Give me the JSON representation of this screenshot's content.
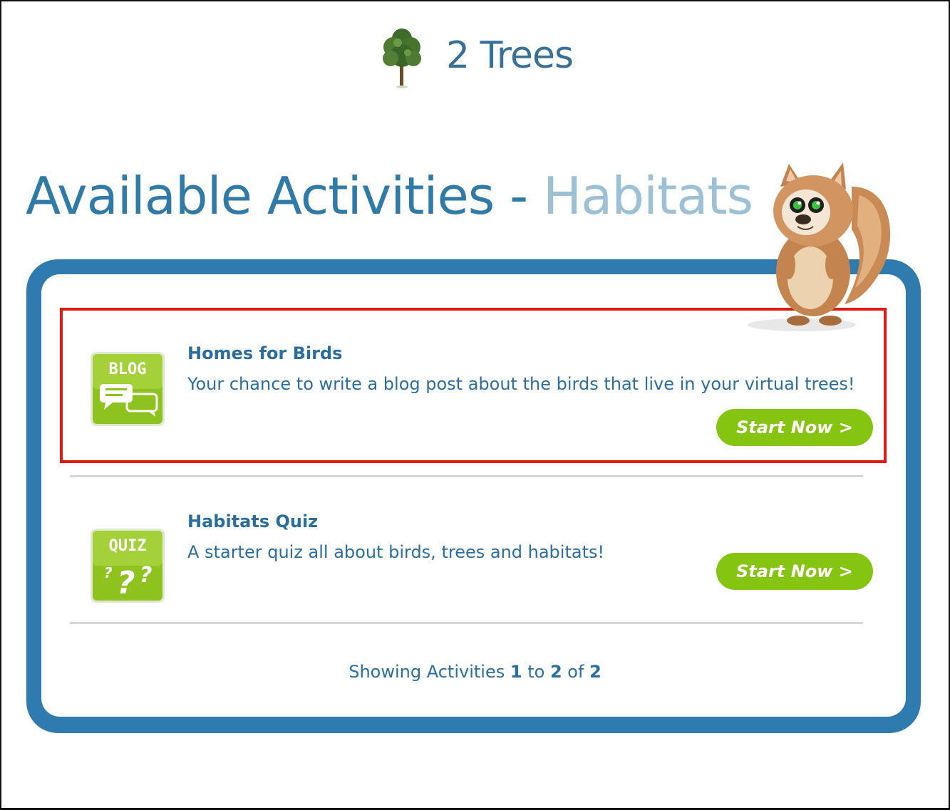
{
  "brand": {
    "name": "2 Trees"
  },
  "page": {
    "title_main": "Available Activities",
    "title_sep": "-",
    "title_sub": "Habitats"
  },
  "activities": [
    {
      "icon_name": "blog-icon",
      "icon_label": "BLOG",
      "title": "Homes for Birds",
      "description": "Your chance to write a blog post about the birds that live in your virtual trees!",
      "button_label": "Start Now >"
    },
    {
      "icon_name": "quiz-icon",
      "icon_label": "QUIZ",
      "title": "Habitats Quiz",
      "description": "A starter quiz all about birds, trees and habitats!",
      "button_label": "Start Now >"
    }
  ],
  "pager": {
    "prefix": "Showing Activities",
    "from": "1",
    "to_word": "to",
    "to": "2",
    "of_word": "of",
    "total": "2"
  },
  "colors": {
    "brand_blue": "#3a6f98",
    "panel_blue": "#2f7aaf",
    "button_green": "#85c411",
    "highlight_red": "#e01b12",
    "subtitle_blue": "#9cc0d6"
  }
}
